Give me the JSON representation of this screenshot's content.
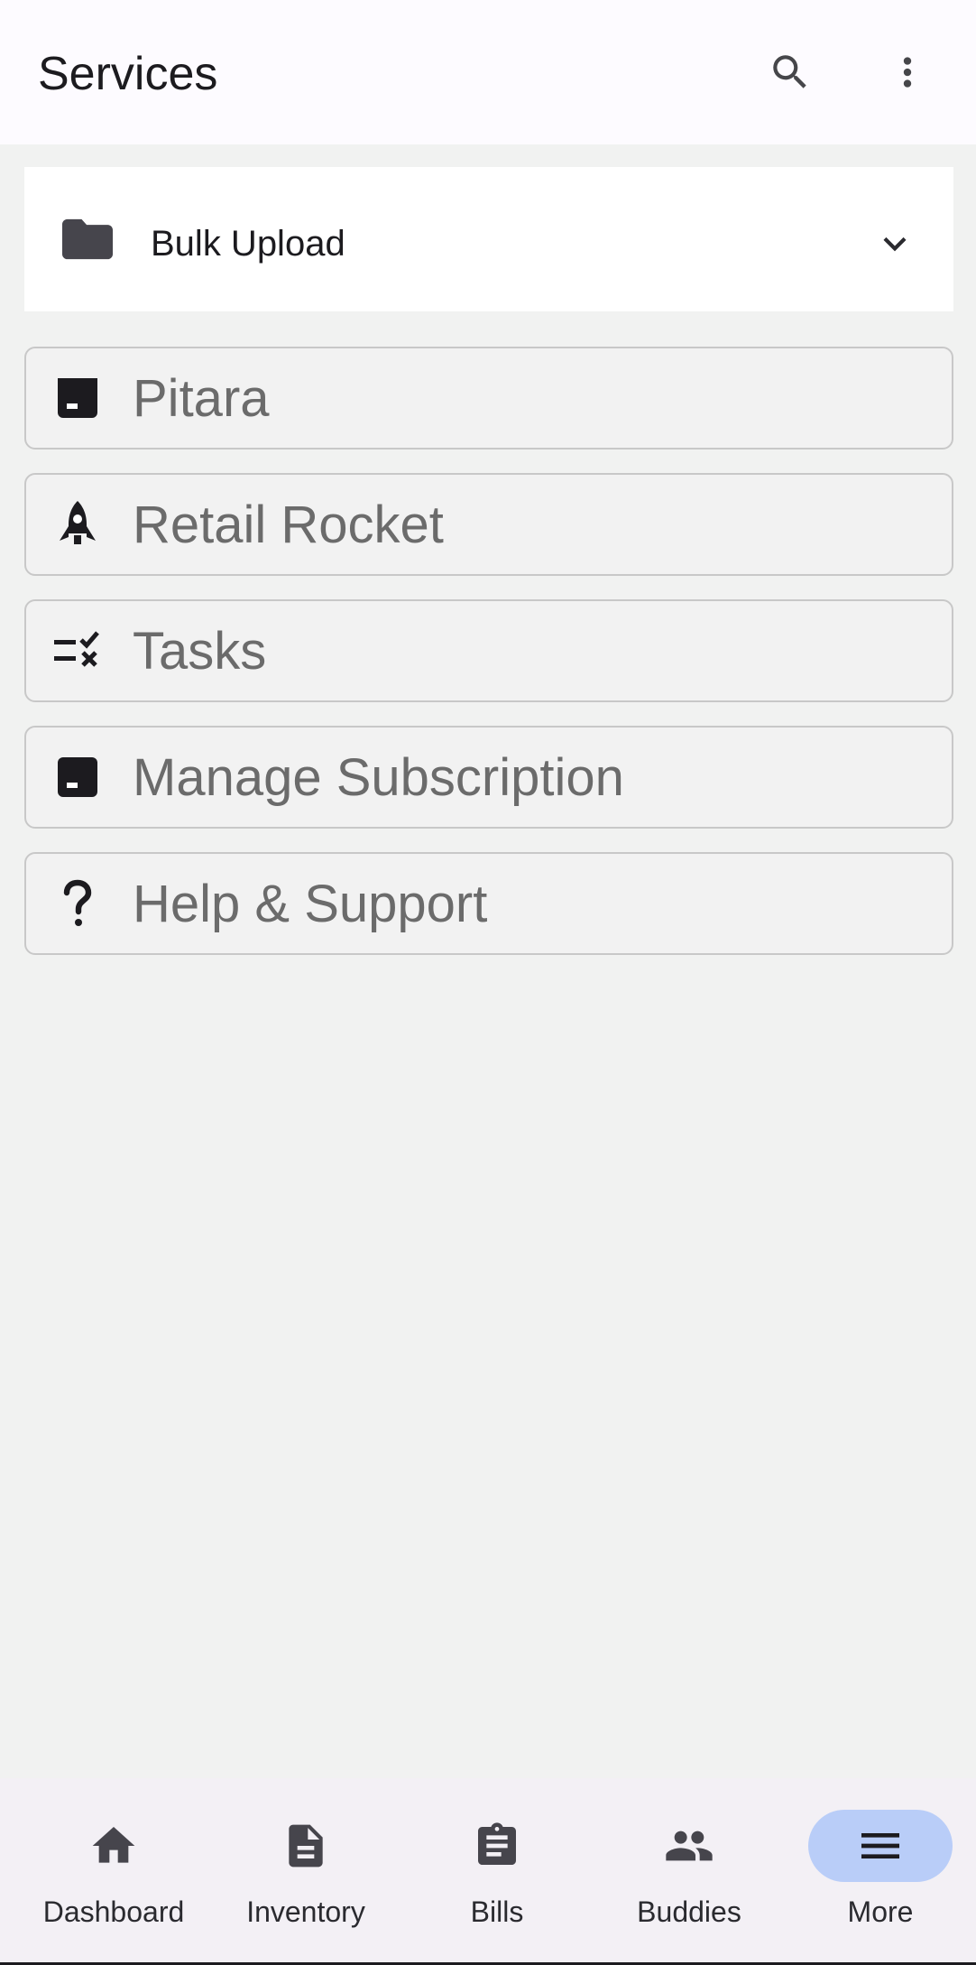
{
  "header": {
    "title": "Services",
    "search_icon": "search-icon",
    "more_icon": "more-vert-icon"
  },
  "bulk_upload": {
    "label": "Bulk Upload",
    "icon": "folder-icon",
    "expand_icon": "chevron-down-icon"
  },
  "services": [
    {
      "label": "Pitara",
      "icon": "archive-box-icon"
    },
    {
      "label": "Retail Rocket",
      "icon": "rocket-icon"
    },
    {
      "label": "Tasks",
      "icon": "checklist-icon"
    },
    {
      "label": "Manage Subscription",
      "icon": "archive-box-icon"
    },
    {
      "label": "Help & Support",
      "icon": "question-mark-icon"
    }
  ],
  "bottom_nav": [
    {
      "label": "Dashboard",
      "icon": "home-icon",
      "active": false
    },
    {
      "label": "Inventory",
      "icon": "document-icon",
      "active": false
    },
    {
      "label": "Bills",
      "icon": "clipboard-icon",
      "active": false
    },
    {
      "label": "Buddies",
      "icon": "people-icon",
      "active": false
    },
    {
      "label": "More",
      "icon": "menu-icon",
      "active": true
    }
  ],
  "colors": {
    "active_nav_pill": "#b9cdf8",
    "background": "#f1f2f1",
    "card_text": "#6b6b6b"
  }
}
